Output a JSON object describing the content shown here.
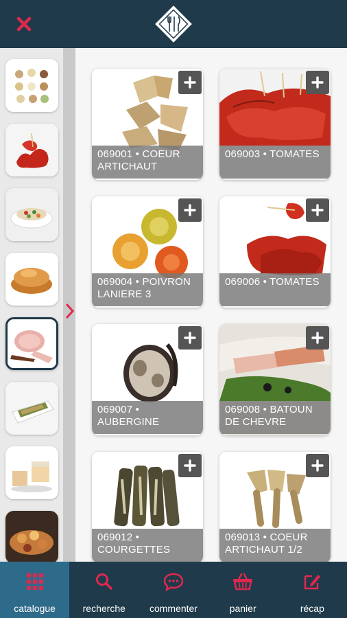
{
  "header": {
    "close_icon": "close-icon",
    "logo_icon": "fork-knife-logo-icon"
  },
  "sidebar": {
    "selected_index": 4,
    "categories": [
      {
        "icon": "canapes-thumbnail"
      },
      {
        "icon": "tomato-skewers-thumbnail"
      },
      {
        "icon": "salad-bowl-thumbnail"
      },
      {
        "icon": "pastry-thumbnail"
      },
      {
        "icon": "ham-thumbnail"
      },
      {
        "icon": "terrine-dish-thumbnail"
      },
      {
        "icon": "foie-gras-thumbnail"
      },
      {
        "icon": "platter-thumbnail"
      }
    ]
  },
  "products": [
    {
      "label": "069001 • COEUR ARTICHAUT",
      "add_icon": "plus-icon"
    },
    {
      "label": "069003 • TOMATES",
      "add_icon": "plus-icon"
    },
    {
      "label": "069004 • POIVRON LANIERE 3",
      "add_icon": "plus-icon"
    },
    {
      "label": "069006 • TOMATES",
      "add_icon": "plus-icon"
    },
    {
      "label": "069007 • AUBERGINE",
      "add_icon": "plus-icon"
    },
    {
      "label": "069008 • BATOUN DE CHEVRE",
      "add_icon": "plus-icon"
    },
    {
      "label": "069012 • COURGETTES",
      "add_icon": "plus-icon"
    },
    {
      "label": "069013 • COEUR ARTICHAUT 1/2",
      "add_icon": "plus-icon"
    }
  ],
  "nav": {
    "active": "catalogue",
    "items": [
      {
        "label": "catalogue",
        "icon": "grid-icon"
      },
      {
        "label": "recherche",
        "icon": "search-icon"
      },
      {
        "label": "commenter",
        "icon": "comment-icon"
      },
      {
        "label": "panier",
        "icon": "basket-icon"
      },
      {
        "label": "récap",
        "icon": "edit-icon"
      }
    ]
  },
  "colors": {
    "header_bg": "#1f3a4a",
    "accent": "#e0284f",
    "nav_active_bg": "#2e6a8a",
    "label_overlay": "#787878"
  }
}
